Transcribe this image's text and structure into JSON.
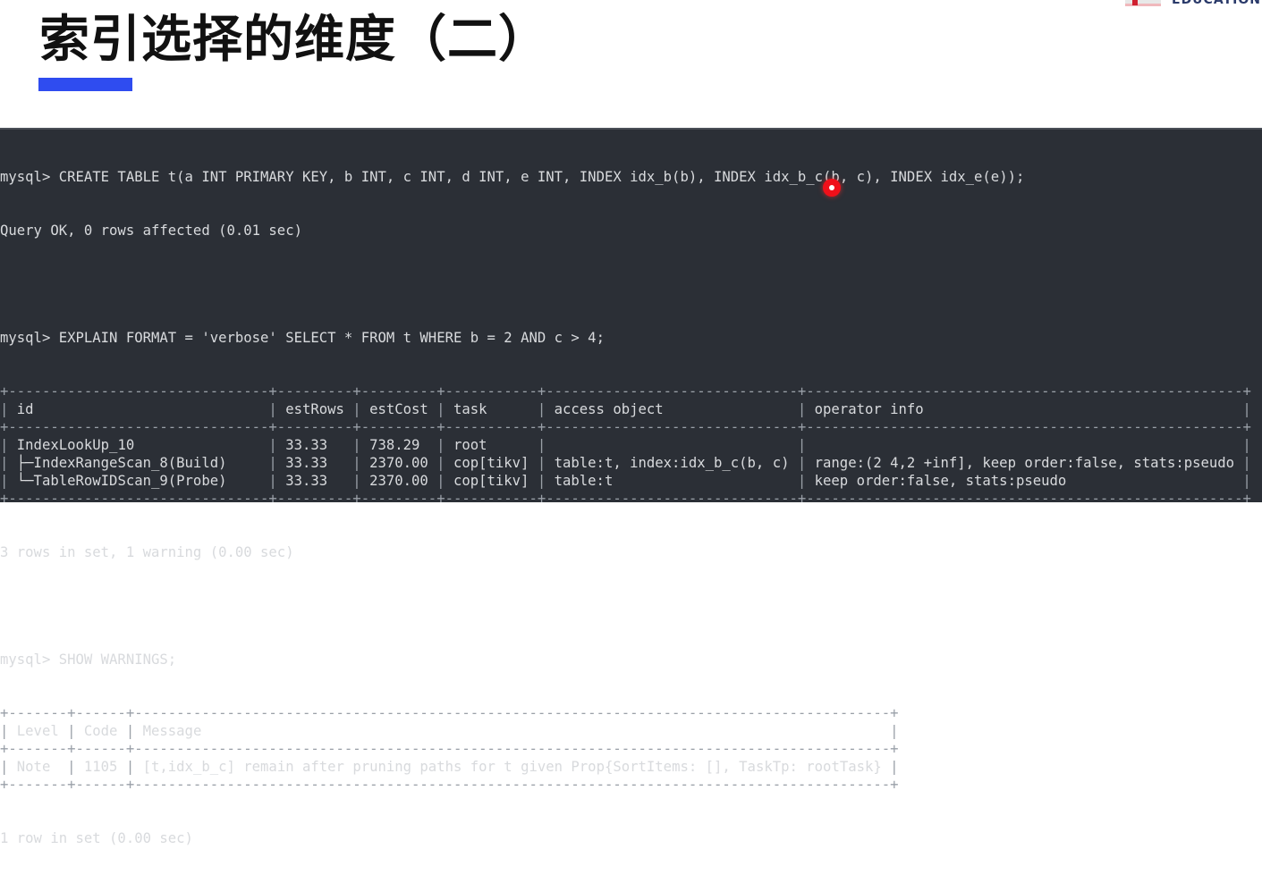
{
  "slide": {
    "title": "索引选择的维度（二）",
    "accent_color": "#2f4cf0",
    "logo_text": "EDUCATION"
  },
  "terminal": {
    "cmd1": "mysql> CREATE TABLE t(a INT PRIMARY KEY, b INT, c INT, d INT, e INT, INDEX idx_b(b), INDEX idx_b_c(b, c), INDEX idx_e(e));",
    "out1": "Query OK, 0 rows affected (0.01 sec)",
    "cmd2": "mysql> EXPLAIN FORMAT = 'verbose' SELECT * FROM t WHERE b = 2 AND c > 4;",
    "explain": {
      "headers": [
        "id",
        "estRows",
        "estCost",
        "task",
        "access object",
        "operator info"
      ],
      "rows": [
        [
          "IndexLookUp_10",
          "33.33",
          "738.29",
          "root",
          "",
          ""
        ],
        [
          "├─IndexRangeScan_8(Build)",
          "33.33",
          "2370.00",
          "cop[tikv]",
          "table:t, index:idx_b_c(b, c)",
          "range:(2 4,2 +inf], keep order:false, stats:pseudo"
        ],
        [
          "└─TableRowIDScan_9(Probe)",
          "33.33",
          "2370.00",
          "cop[tikv]",
          "table:t",
          "keep order:false, stats:pseudo"
        ]
      ]
    },
    "out2": "3 rows in set, 1 warning (0.00 sec)",
    "cmd3": "mysql> SHOW WARNINGS;",
    "warnings": {
      "headers": [
        "Level",
        "Code",
        "Message"
      ],
      "rows": [
        [
          "Note",
          "1105",
          "[t,idx_b_c] remain after pruning paths for t given Prop{SortItems: [], TaskTp: rootTask}"
        ]
      ]
    },
    "out3": "1 row in set (0.00 sec)"
  }
}
